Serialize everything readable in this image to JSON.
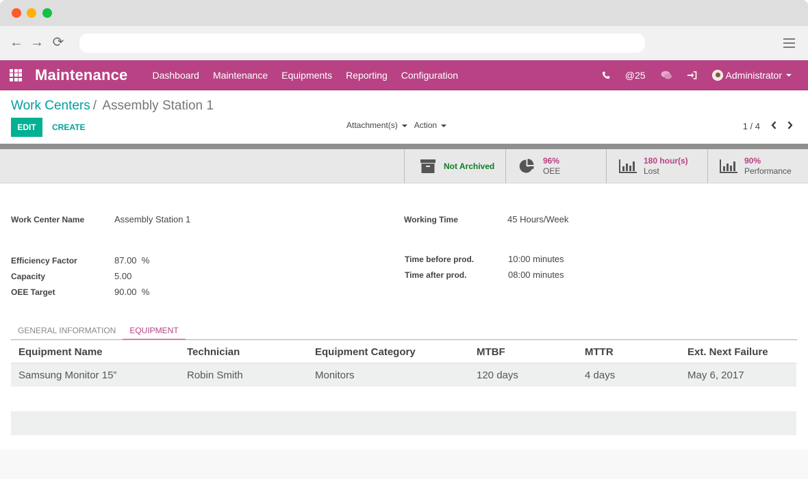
{
  "browser": {
    "url_value": "",
    "url_placeholder": "",
    "back_icon": "←",
    "forward_icon": "→",
    "reload_icon": "⟳"
  },
  "appnav": {
    "app_title": "Maintenance",
    "menu": [
      "Dashboard",
      "Maintenance",
      "Equipments",
      "Reporting",
      "Configuration"
    ],
    "phone_icon": "✆",
    "mentions_label": "@25",
    "chat_icon": "💬",
    "login_icon": "➜",
    "user_name": "Administrator"
  },
  "control_panel": {
    "breadcrumb_parent": "Work Centers",
    "breadcrumb_sep": "/",
    "breadcrumb_current": "Assembly Station 1",
    "edit_label": "EDIT",
    "create_label": "CREATE",
    "attachments_label": "Attachment(s)",
    "action_label": "Action",
    "pager_value": "1 / 4",
    "pager_prev": "‹",
    "pager_next": "›"
  },
  "stat_buttons": {
    "archived": "Not Archived",
    "oee": {
      "value": "96%",
      "label": "OEE"
    },
    "lost": {
      "value": "180 hour(s)",
      "label": "Lost"
    },
    "performance": {
      "value": "90%",
      "label": "Performance"
    }
  },
  "form": {
    "work_center_name": {
      "label": "Work Center Name",
      "value": "Assembly Station 1"
    },
    "working_time": {
      "label": "Working Time",
      "value": "45 Hours/Week"
    },
    "efficiency_factor": {
      "label": "Efficiency Factor",
      "value": "87.00  %"
    },
    "capacity": {
      "label": "Capacity",
      "value": "5.00"
    },
    "oee_target": {
      "label": "OEE Target",
      "value": "90.00  %"
    },
    "time_before": {
      "label": "Time before prod.",
      "value": "10:00 minutes"
    },
    "time_after": {
      "label": "Time after prod.",
      "value": "08:00 minutes"
    }
  },
  "tabs": [
    {
      "label": "GENERAL INFORMATION",
      "active": false
    },
    {
      "label": "EQUIPMENT",
      "active": true
    }
  ],
  "equipment_table": {
    "columns": [
      "Equipment Name",
      "Technician",
      "Equipment Category",
      "MTBF",
      "MTTR",
      "Ext. Next Failure"
    ],
    "rows": [
      [
        "Samsung Monitor 15”",
        "Robin Smith",
        "Monitors",
        "120 days",
        "4 days",
        "May 6, 2017"
      ]
    ]
  },
  "colors": {
    "brand": "#b84284",
    "primary_button": "#00b193",
    "link": "#00a09d",
    "archived_green": "#0f7b25"
  }
}
